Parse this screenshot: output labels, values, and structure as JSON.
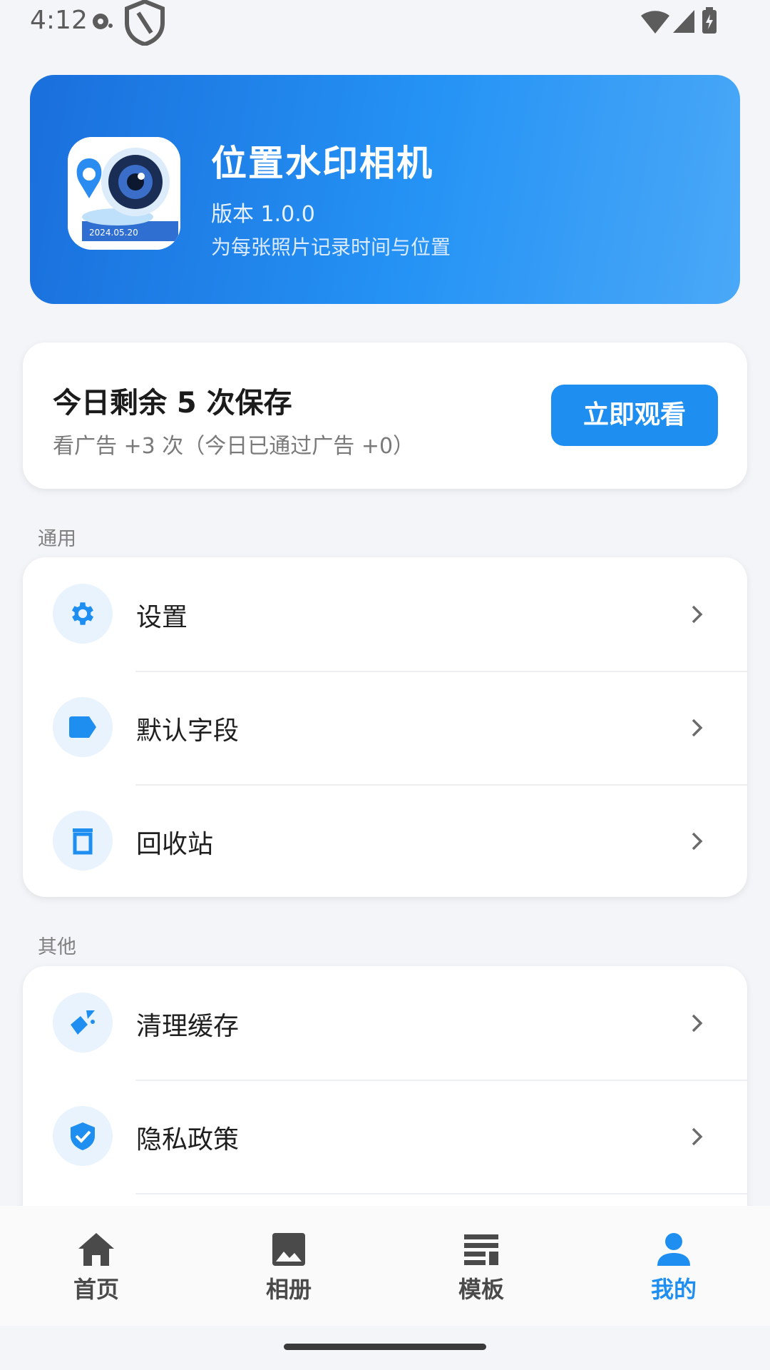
{
  "status_bar": {
    "time": "4:12"
  },
  "header": {
    "app_name": "位置水印相机",
    "version": "版本 1.0.0",
    "slogan": "为每张照片记录时间与位置",
    "icon_date_text": "2024.05.20"
  },
  "quota": {
    "title": "今日剩余 5 次保存",
    "subtitle": "看广告 +3 次（今日已通过广告 +0）",
    "button_label": "立即观看"
  },
  "sections": {
    "general": {
      "label": "通用",
      "items": [
        {
          "label": "设置",
          "icon": "gear-icon"
        },
        {
          "label": "默认字段",
          "icon": "tag-icon"
        },
        {
          "label": "回收站",
          "icon": "trash-icon"
        }
      ]
    },
    "other": {
      "label": "其他",
      "items": [
        {
          "label": "清理缓存",
          "icon": "broom-icon"
        },
        {
          "label": "隐私政策",
          "icon": "shield-check-icon"
        }
      ]
    }
  },
  "bottom_nav": {
    "items": [
      {
        "label": "首页",
        "icon": "home-icon"
      },
      {
        "label": "相册",
        "icon": "image-icon"
      },
      {
        "label": "模板",
        "icon": "template-icon"
      },
      {
        "label": "我的",
        "icon": "person-icon",
        "active": true
      }
    ]
  },
  "colors": {
    "accent": "#1f8ef1",
    "background": "#f3f5f9",
    "icon_bg": "#e9f3fe"
  }
}
